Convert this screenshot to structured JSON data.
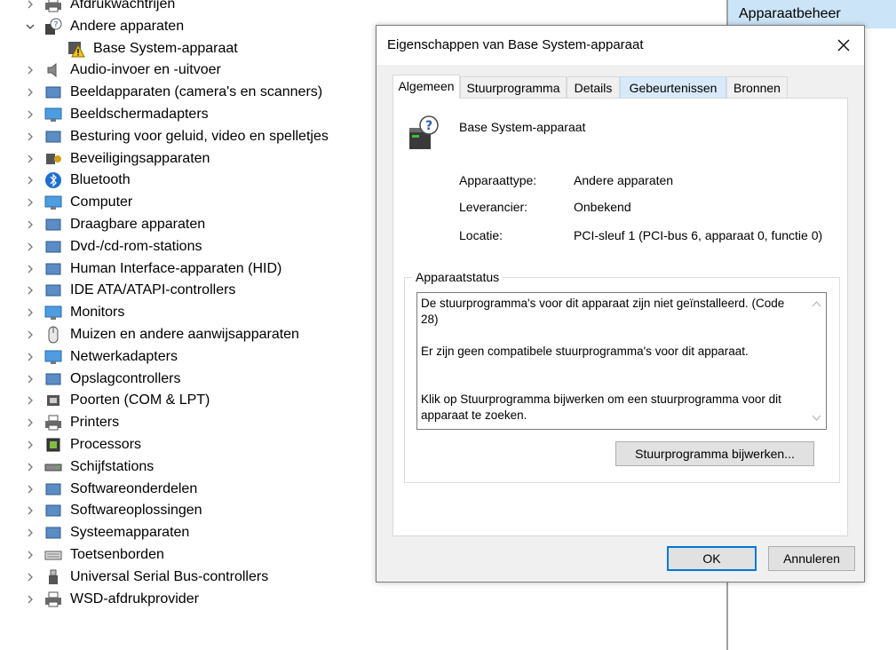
{
  "tree": {
    "items": [
      {
        "label": "Afdrukwachtrijen",
        "icon": "printer-queue-icon",
        "expanded": false
      },
      {
        "label": "Andere apparaten",
        "icon": "unknown-device-icon",
        "expanded": true
      },
      {
        "label": "Base System-apparaat",
        "icon": "warning-device-icon",
        "child": true
      },
      {
        "label": "Audio-invoer en -uitvoer",
        "icon": "speaker-icon",
        "expanded": false
      },
      {
        "label": "Beeldapparaten (camera's en scanners)",
        "icon": "camera-icon",
        "expanded": false
      },
      {
        "label": "Beeldschermadapters",
        "icon": "display-adapter-icon",
        "expanded": false
      },
      {
        "label": "Besturing voor geluid, video en spelletjes",
        "icon": "sound-video-icon",
        "expanded": false
      },
      {
        "label": "Beveiligingsapparaten",
        "icon": "security-device-icon",
        "expanded": false
      },
      {
        "label": "Bluetooth",
        "icon": "bluetooth-icon",
        "expanded": false
      },
      {
        "label": "Computer",
        "icon": "computer-icon",
        "expanded": false
      },
      {
        "label": "Draagbare apparaten",
        "icon": "portable-device-icon",
        "expanded": false
      },
      {
        "label": "Dvd-/cd-rom-stations",
        "icon": "dvd-drive-icon",
        "expanded": false
      },
      {
        "label": "Human Interface-apparaten (HID)",
        "icon": "hid-icon",
        "expanded": false
      },
      {
        "label": "IDE ATA/ATAPI-controllers",
        "icon": "ide-controller-icon",
        "expanded": false
      },
      {
        "label": "Monitors",
        "icon": "monitor-icon",
        "expanded": false
      },
      {
        "label": "Muizen en andere aanwijsapparaten",
        "icon": "mouse-icon",
        "expanded": false
      },
      {
        "label": "Netwerkadapters",
        "icon": "network-adapter-icon",
        "expanded": false
      },
      {
        "label": "Opslagcontrollers",
        "icon": "storage-controller-icon",
        "expanded": false
      },
      {
        "label": "Poorten (COM & LPT)",
        "icon": "port-icon",
        "expanded": false
      },
      {
        "label": "Printers",
        "icon": "printer-icon",
        "expanded": false
      },
      {
        "label": "Processors",
        "icon": "processor-icon",
        "expanded": false
      },
      {
        "label": "Schijfstations",
        "icon": "disk-drive-icon",
        "expanded": false
      },
      {
        "label": "Softwareonderdelen",
        "icon": "software-component-icon",
        "expanded": false
      },
      {
        "label": "Softwareoplossingen",
        "icon": "software-device-icon",
        "expanded": false
      },
      {
        "label": "Systeemapparaten",
        "icon": "system-device-icon",
        "expanded": false
      },
      {
        "label": "Toetsenborden",
        "icon": "keyboard-icon",
        "expanded": false
      },
      {
        "label": "Universal Serial Bus-controllers",
        "icon": "usb-icon",
        "expanded": false
      },
      {
        "label": "WSD-afdrukprovider",
        "icon": "wsd-print-icon",
        "expanded": false
      }
    ]
  },
  "right_pane": {
    "header": "Apparaatbeheer"
  },
  "dialog": {
    "title": "Eigenschappen van Base System-apparaat",
    "tabs": [
      "Algemeen",
      "Stuurprogramma",
      "Details",
      "Gebeurtenissen",
      "Bronnen"
    ],
    "active_tab": "Algemeen",
    "device_name": "Base System-apparaat",
    "properties": [
      {
        "label": "Apparaattype:",
        "value": "Andere apparaten"
      },
      {
        "label": "Leverancier:",
        "value": "Onbekend"
      },
      {
        "label": "Locatie:",
        "value": "PCI-sleuf 1 (PCI-bus 6, apparaat 0, functie 0)"
      }
    ],
    "status_group_label": "Apparaatstatus",
    "status_lines": [
      "De stuurprogramma's voor dit apparaat zijn niet geïnstalleerd. (Code 28)",
      "Er zijn geen compatibele stuurprogramma's voor dit apparaat.",
      "Klik op Stuurprogramma bijwerken om een stuurprogramma voor dit apparaat te zoeken."
    ],
    "update_driver_button": "Stuurprogramma bijwerken...",
    "ok_button": "OK",
    "cancel_button": "Annuleren"
  },
  "colors": {
    "accent": "#0078d7",
    "selection": "#cce4f7",
    "dialog_bg": "#f0f0f0"
  }
}
